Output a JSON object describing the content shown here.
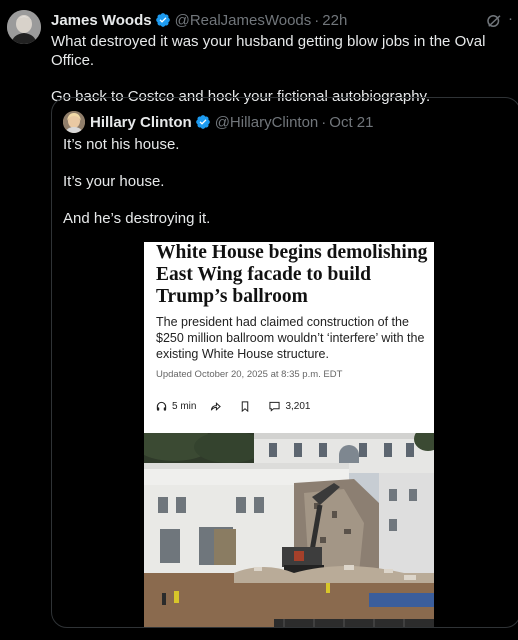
{
  "author": {
    "name": "James Woods",
    "handle": "@RealJamesWoods",
    "separator": "·",
    "time": "22h"
  },
  "tweet": {
    "paragraphs": [
      "What destroyed it was your husband getting blow jobs in the Oval Office.",
      "Go back to Costco and hock your fictional autobiography."
    ]
  },
  "quoted": {
    "name": "Hillary Clinton",
    "handle": "@HillaryClinton",
    "separator": "·",
    "time": "Oct 21",
    "paragraphs": [
      "It’s not his house.",
      "It’s your house.",
      "And he’s destroying it."
    ]
  },
  "article": {
    "headline": "White House begins demolishing East Wing facade to build Trump’s ballroom",
    "dek": "The president had claimed construction of the $250 million ballroom wouldn’t ‘interfere’ with the existing White House structure.",
    "updated": "Updated October 20, 2025 at 8:35 p.m. EDT",
    "read_time": "5 min",
    "comments": "3,201"
  },
  "colors": {
    "verified": "#1d9bf0",
    "muted": "#71767b",
    "text": "#e7e9ea",
    "border": "#2f3336"
  },
  "icons": [
    "verified-badge-icon",
    "grok-icon",
    "more-icon",
    "headphones-icon",
    "share-icon",
    "bookmark-icon",
    "comment-icon"
  ]
}
